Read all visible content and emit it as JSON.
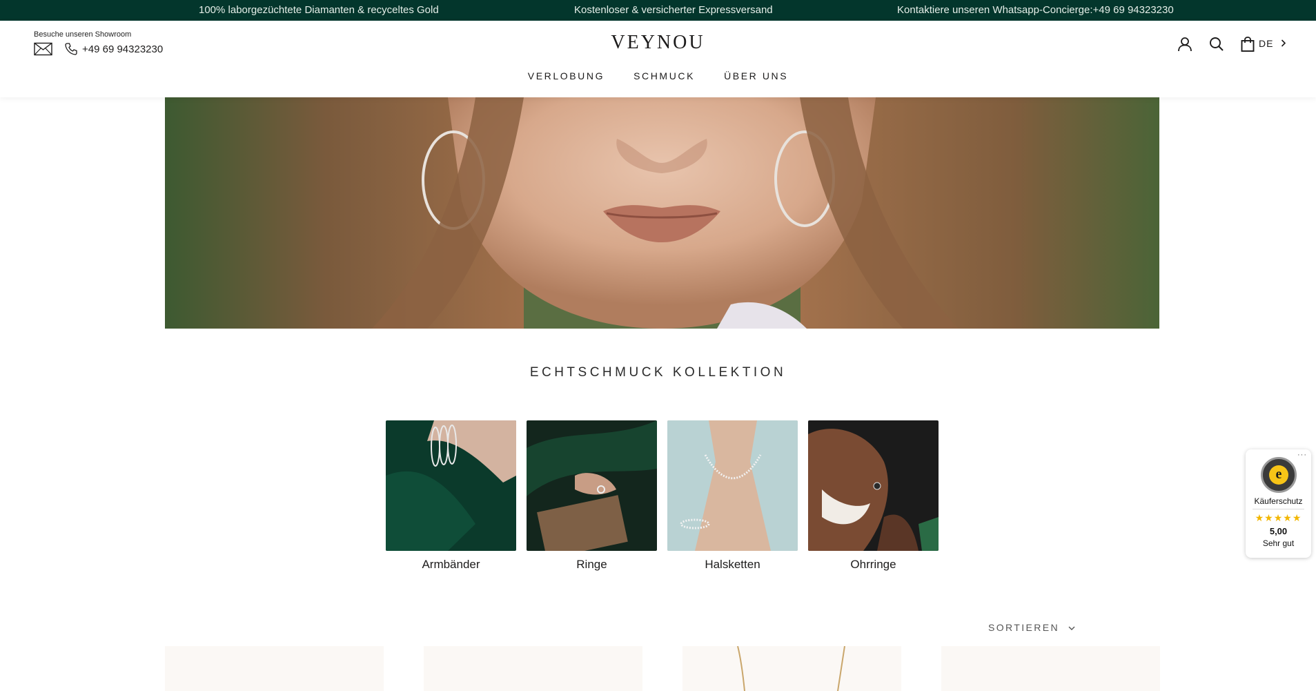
{
  "announcement": {
    "item1": "100% laborgezüchtete Diamanten & recyceltes Gold",
    "item2": "Kostenloser & versicherter Expressversand",
    "item3": "Kontaktiere unseren Whatsapp-Concierge:+49 69 94323230"
  },
  "header": {
    "showroom_label": "Besuche unseren Showroom",
    "phone": "+49 69 94323230",
    "logo": "VEYNOU",
    "nav": [
      "VERLOBUNG",
      "SCHMUCK",
      "ÜBER UNS"
    ],
    "language": "DE",
    "icons": [
      "mail-icon",
      "phone-icon",
      "user-icon",
      "search-icon",
      "shopping-bag-icon",
      "chevron-right-icon"
    ]
  },
  "collection": {
    "title": "ECHTSCHMUCK KOLLEKTION",
    "categories": [
      {
        "label": "Armbänder"
      },
      {
        "label": "Ringe"
      },
      {
        "label": "Halsketten"
      },
      {
        "label": "Ohrringe"
      }
    ]
  },
  "sort": {
    "label": "SORTIEREN"
  },
  "trusted_shops": {
    "title": "Käuferschutz",
    "stars": "★★★★★",
    "score": "5,00",
    "grade": "Sehr gut",
    "dots": "···"
  },
  "colors": {
    "announcement_bg": "#03362c",
    "star": "#f2b600",
    "text": "#1c1b1b"
  }
}
